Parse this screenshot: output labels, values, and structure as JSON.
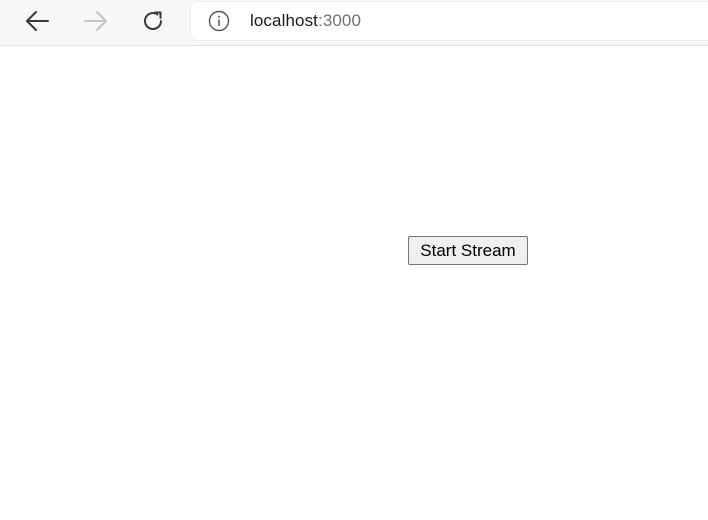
{
  "browser": {
    "back_icon": "arrow-left-icon",
    "forward_icon": "arrow-right-icon",
    "reload_icon": "reload-icon",
    "info_icon": "info-circle-icon",
    "url_host": "localhost",
    "url_port": ":3000"
  },
  "page": {
    "start_stream_label": "Start Stream"
  }
}
